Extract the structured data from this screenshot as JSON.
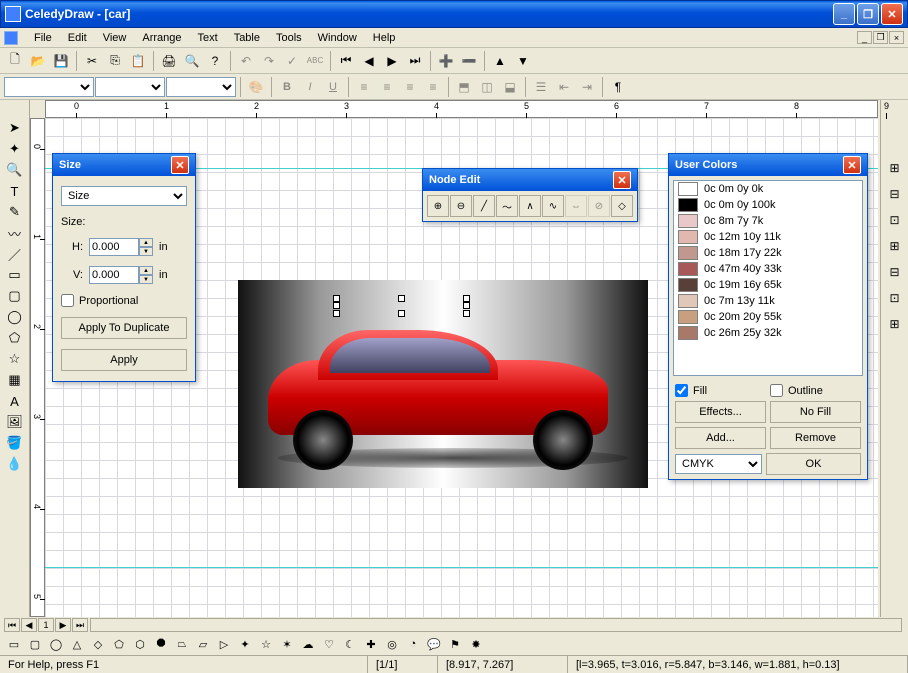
{
  "title": "CeledyDraw - [car]",
  "menu": [
    "File",
    "Edit",
    "View",
    "Arrange",
    "Text",
    "Table",
    "Tools",
    "Window",
    "Help"
  ],
  "size_panel": {
    "title": "Size",
    "combo": "Size",
    "label": "Size:",
    "h_label": "H:",
    "v_label": "V:",
    "h_value": "0.000",
    "v_value": "0.000",
    "unit": "in",
    "proportional": "Proportional",
    "apply_dup": "Apply To Duplicate",
    "apply": "Apply"
  },
  "node_panel": {
    "title": "Node Edit"
  },
  "colors_panel": {
    "title": "User Colors",
    "items": [
      {
        "hex": "#ffffff",
        "label": "0c 0m 0y 0k"
      },
      {
        "hex": "#000000",
        "label": "0c 0m 0y 100k"
      },
      {
        "hex": "#e8c8c8",
        "label": "0c 8m 7y 7k"
      },
      {
        "hex": "#e0b8b0",
        "label": "0c 12m 10y 11k"
      },
      {
        "hex": "#c09890",
        "label": "0c 18m 17y 22k"
      },
      {
        "hex": "#a85858",
        "label": "0c 47m 40y 33k"
      },
      {
        "hex": "#584038",
        "label": "0c 19m 16y 65k"
      },
      {
        "hex": "#e0c8b8",
        "label": "0c 7m 13y 11k"
      },
      {
        "hex": "#c8a080",
        "label": "0c 20m 20y 55k"
      },
      {
        "hex": "#a87868",
        "label": "0c 26m 25y 32k"
      }
    ],
    "fill": "Fill",
    "outline": "Outline",
    "effects": "Effects...",
    "nofill": "No Fill",
    "add": "Add...",
    "remove": "Remove",
    "mode": "CMYK",
    "ok": "OK"
  },
  "status": {
    "help": "For Help, press F1",
    "page": "[1/1]",
    "coord": "[8.917, 7.267]",
    "dims": "[l=3.965, t=3.016, r=5.847, b=3.146, w=1.881, h=0.13]"
  },
  "ruler_nums": [
    "0",
    "1",
    "2",
    "3",
    "4",
    "5",
    "6",
    "7",
    "8",
    "9"
  ]
}
